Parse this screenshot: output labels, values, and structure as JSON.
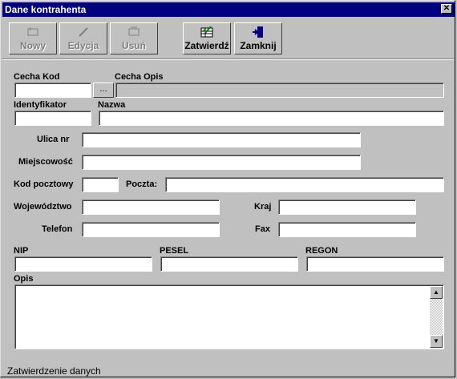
{
  "window": {
    "title": "Dane kontrahenta",
    "close": "✕"
  },
  "toolbar": {
    "new": "Nowy",
    "edit": "Edycja",
    "delete": "Usuń",
    "confirm": "Zatwierdź",
    "close": "Zamknij"
  },
  "fields": {
    "cecha_kod": {
      "label": "Cecha Kod",
      "value": ""
    },
    "browse": "...",
    "cecha_opis": {
      "label": "Cecha Opis",
      "value": ""
    },
    "identyfikator": {
      "label": "Identyfikator",
      "value": ""
    },
    "nazwa": {
      "label": "Nazwa",
      "value": ""
    },
    "ulica": {
      "label": "Ulica nr",
      "value": ""
    },
    "miejscowosc": {
      "label": "Miejscowość",
      "value": ""
    },
    "kod_pocztowy": {
      "label": "Kod pocztowy",
      "value": ""
    },
    "poczta": {
      "label": "Poczta:",
      "value": ""
    },
    "wojewodztwo": {
      "label": "Województwo",
      "value": ""
    },
    "kraj": {
      "label": "Kraj",
      "value": ""
    },
    "telefon": {
      "label": "Telefon",
      "value": ""
    },
    "fax": {
      "label": "Fax",
      "value": ""
    },
    "nip": {
      "label": "NIP",
      "value": ""
    },
    "pesel": {
      "label": "PESEL",
      "value": ""
    },
    "regon": {
      "label": "REGON",
      "value": ""
    },
    "opis": {
      "label": "Opis",
      "value": ""
    }
  },
  "status": "Zatwierdzenie danych"
}
